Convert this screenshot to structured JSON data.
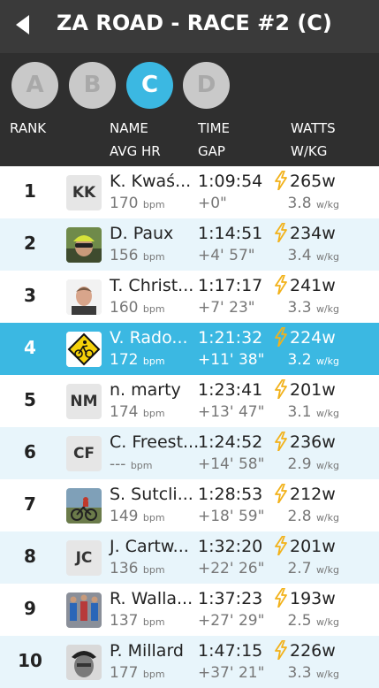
{
  "header": {
    "title": "ZA ROAD - RACE #2 (C)"
  },
  "categories": [
    {
      "label": "A",
      "active": false
    },
    {
      "label": "B",
      "active": false
    },
    {
      "label": "C",
      "active": true
    },
    {
      "label": "D",
      "active": false
    }
  ],
  "columns": {
    "rank": "RANK",
    "name": "NAME",
    "avg_hr": "AVG HR",
    "time": "TIME",
    "gap": "GAP",
    "watts": "WATTS",
    "wkg": "W/KG"
  },
  "units": {
    "bpm": "bpm",
    "wkg": "w/kg"
  },
  "colors": {
    "accent": "#3bb8e2",
    "bolt": "#f2b21b",
    "header": "#3a3a3a"
  },
  "rows": [
    {
      "rank": "1",
      "avatar_text": "KK",
      "avatar": "initials",
      "name": "K. Kwaś...",
      "hr": "170",
      "time": "1:09:54",
      "gap": "+0\"",
      "watts": "265w",
      "wkg": "3.8"
    },
    {
      "rank": "2",
      "avatar_text": "",
      "avatar": "photo-cyclist-helmet",
      "name": "D. Paux",
      "hr": "156",
      "time": "1:14:51",
      "gap": "+4' 57\"",
      "watts": "234w",
      "wkg": "3.4"
    },
    {
      "rank": "3",
      "avatar_text": "",
      "avatar": "photo-man-portrait",
      "name": "T. Christ...",
      "hr": "160",
      "time": "1:17:17",
      "gap": "+7' 23\"",
      "watts": "241w",
      "wkg": "3.3"
    },
    {
      "rank": "4",
      "avatar_text": "",
      "avatar": "cyclist-road-sign",
      "name": "V. Rado...",
      "hr": "172",
      "time": "1:21:32",
      "gap": "+11' 38\"",
      "watts": "224w",
      "wkg": "3.2"
    },
    {
      "rank": "5",
      "avatar_text": "NM",
      "avatar": "initials",
      "name": "n. marty",
      "hr": "174",
      "time": "1:23:41",
      "gap": "+13' 47\"",
      "watts": "201w",
      "wkg": "3.1"
    },
    {
      "rank": "6",
      "avatar_text": "CF",
      "avatar": "initials",
      "name": "C. Freest...",
      "hr": "---",
      "time": "1:24:52",
      "gap": "+14' 58\"",
      "watts": "236w",
      "wkg": "2.9"
    },
    {
      "rank": "7",
      "avatar_text": "",
      "avatar": "photo-mountain-bike",
      "name": "S. Sutcli...",
      "hr": "149",
      "time": "1:28:53",
      "gap": "+18' 59\"",
      "watts": "212w",
      "wkg": "2.8"
    },
    {
      "rank": "8",
      "avatar_text": "JC",
      "avatar": "initials",
      "name": "J. Cartw...",
      "hr": "136",
      "time": "1:32:20",
      "gap": "+22' 26\"",
      "watts": "201w",
      "wkg": "2.7"
    },
    {
      "rank": "9",
      "avatar_text": "",
      "avatar": "photo-runners",
      "name": "R. Walla...",
      "hr": "137",
      "time": "1:37:23",
      "gap": "+27' 29\"",
      "watts": "193w",
      "wkg": "2.5"
    },
    {
      "rank": "10",
      "avatar_text": "",
      "avatar": "photo-man-bw",
      "name": "P. Millard",
      "hr": "177",
      "time": "1:47:15",
      "gap": "+37' 21\"",
      "watts": "226w",
      "wkg": "3.3"
    }
  ],
  "highlighted_rank": "4"
}
